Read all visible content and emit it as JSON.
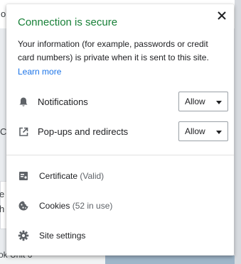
{
  "background": {
    "top_fragment": "ol",
    "left_fragments": [
      "C",
      "e p",
      "h C",
      "ok Unit 6"
    ]
  },
  "popup": {
    "title": "Connection is secure",
    "description": "Your information (for example, passwords or credit card numbers) is private when it is sent to this site.",
    "learn_more": "Learn more",
    "permissions": [
      {
        "icon": "bell-icon",
        "label": "Notifications",
        "value": "Allow"
      },
      {
        "icon": "open-in-new-icon",
        "label": "Pop-ups and redirects",
        "value": "Allow"
      }
    ],
    "links": [
      {
        "icon": "certificate-icon",
        "label": "Certificate",
        "detail": "(Valid)"
      },
      {
        "icon": "cookie-icon",
        "label": "Cookies",
        "detail": "(52 in use)"
      },
      {
        "icon": "gear-icon",
        "label": "Site settings",
        "detail": ""
      }
    ]
  },
  "colors": {
    "secure_green": "#188038",
    "link_blue": "#1a73e8"
  }
}
